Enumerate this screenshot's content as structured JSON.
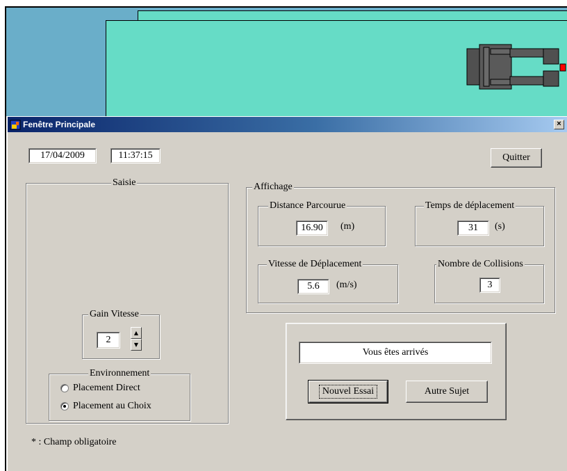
{
  "window": {
    "title": "Fenêtre Principale",
    "close_label": "×"
  },
  "header": {
    "date": "17/04/2009",
    "time": "11:37:15",
    "quit_label": "Quitter"
  },
  "saisie": {
    "title": "Saisie",
    "gain": {
      "title": "Gain Vitesse",
      "value": "2",
      "up_icon": "▲",
      "down_icon": "▼"
    },
    "environment": {
      "title": "Environnement",
      "options": [
        {
          "label": "Placement Direct",
          "selected": false
        },
        {
          "label": "Placement au Choix",
          "selected": true
        }
      ]
    }
  },
  "affichage": {
    "title": "Affichage",
    "distance": {
      "title": "Distance Parcourue",
      "value": "16.90",
      "unit": "(m)"
    },
    "temps": {
      "title": "Temps de déplacement",
      "value": "31",
      "unit": "(s)"
    },
    "vitesse": {
      "title": "Vitesse de Déplacement",
      "value": "5.6",
      "unit": "(m/s)"
    },
    "collisions": {
      "title": "Nombre de Collisions",
      "value": "3"
    }
  },
  "result": {
    "message": "Vous êtes arrivés",
    "new_trial_label": "Nouvel Essai",
    "other_subject_label": "Autre Sujet"
  },
  "footer": {
    "note": "* : Champ obligatoire"
  },
  "colors": {
    "sky": "#6aaec9",
    "field": "#66dcc6",
    "window": "#d4d0c8",
    "titlebar": "#0a246a",
    "robot_marker": "#ff0000"
  }
}
